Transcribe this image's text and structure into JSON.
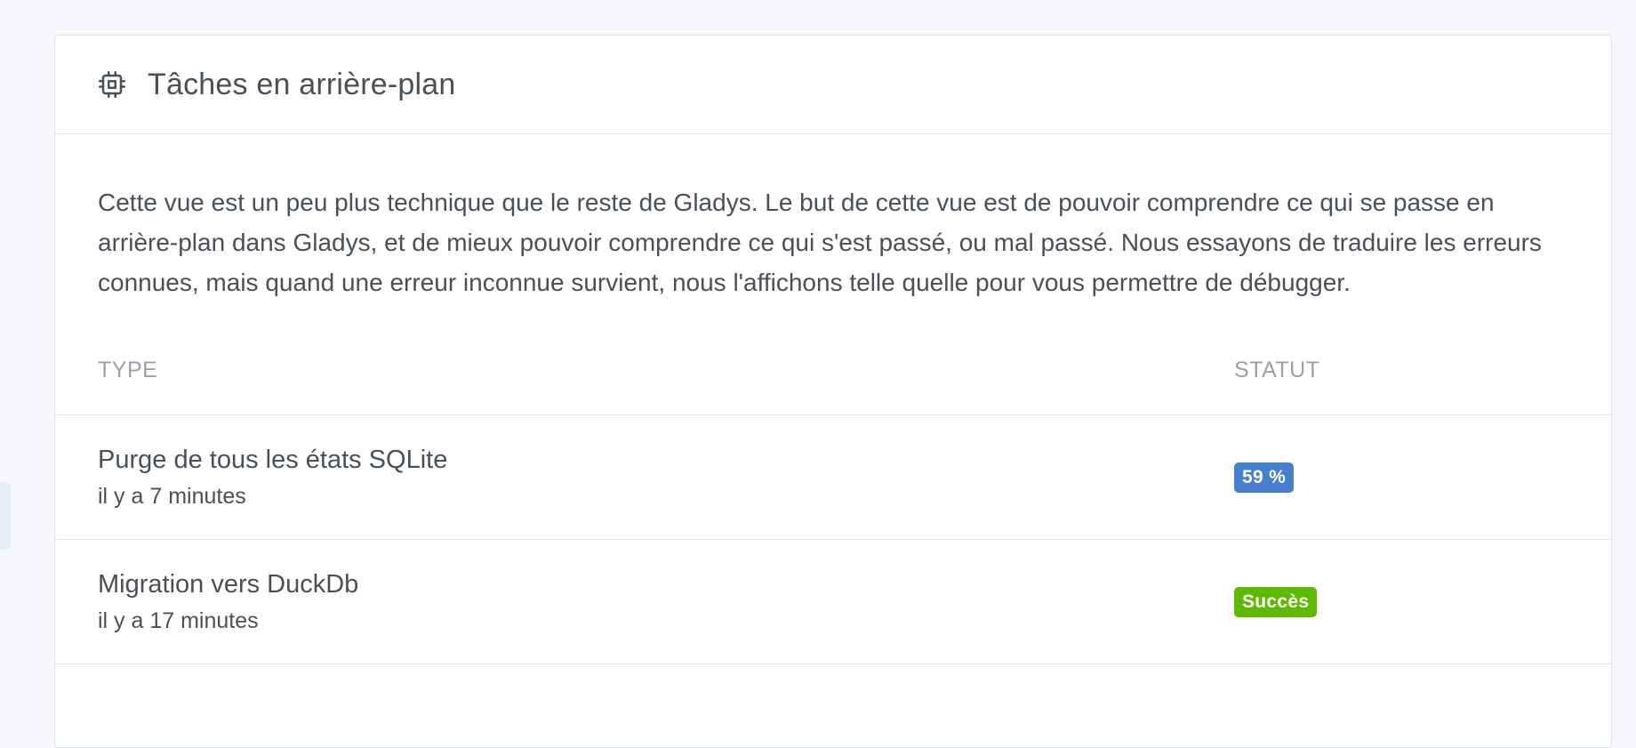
{
  "card": {
    "title": "Tâches en arrière-plan",
    "title_icon": "cpu-icon",
    "description": "Cette vue est un peu plus technique que le reste de Gladys. Le but de cette vue est de pouvoir comprendre ce qui se passe en arrière-plan dans Gladys, et de mieux pouvoir comprendre ce qui s'est passé, ou mal passé. Nous essayons de traduire les erreurs connues, mais quand une erreur inconnue survient, nous l'affichons telle quelle pour vous permettre de débugger."
  },
  "table": {
    "headers": {
      "type": "Type",
      "status": "Statut"
    },
    "rows": [
      {
        "name": "Purge de tous les états SQLite",
        "time": "il y a 7 minutes",
        "status": "59 %",
        "status_color": "#467fcf"
      },
      {
        "name": "Migration vers DuckDb",
        "time": "il y a 17 minutes",
        "status": "Succès",
        "status_color": "#5eba00"
      }
    ]
  }
}
